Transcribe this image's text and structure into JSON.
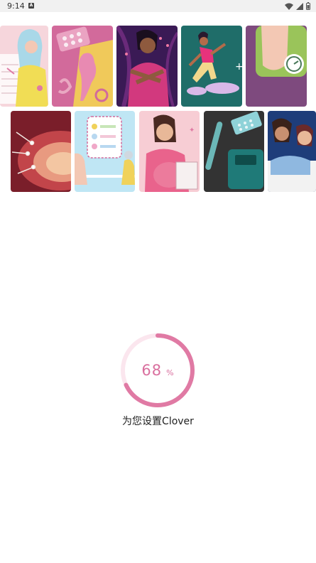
{
  "status_bar": {
    "time": "9:14"
  },
  "loading": {
    "percent": "68",
    "unit": "%",
    "progress_fraction": 0.68,
    "label": "为您设置Clover"
  },
  "colors": {
    "accent": "#e07aa4",
    "track": "#fbe6ee",
    "text_accent": "#d96f9e"
  },
  "illustrations": [
    "woman-with-calendar",
    "pill-packs-pregnancy",
    "woman-hugging-self",
    "woman-running-scale",
    "foot-on-scale",
    "sperm-egg-closeup",
    "doctor-consultation",
    "pregnant-woman-writing",
    "pregnancy-test-scale",
    "couple-in-bed"
  ]
}
